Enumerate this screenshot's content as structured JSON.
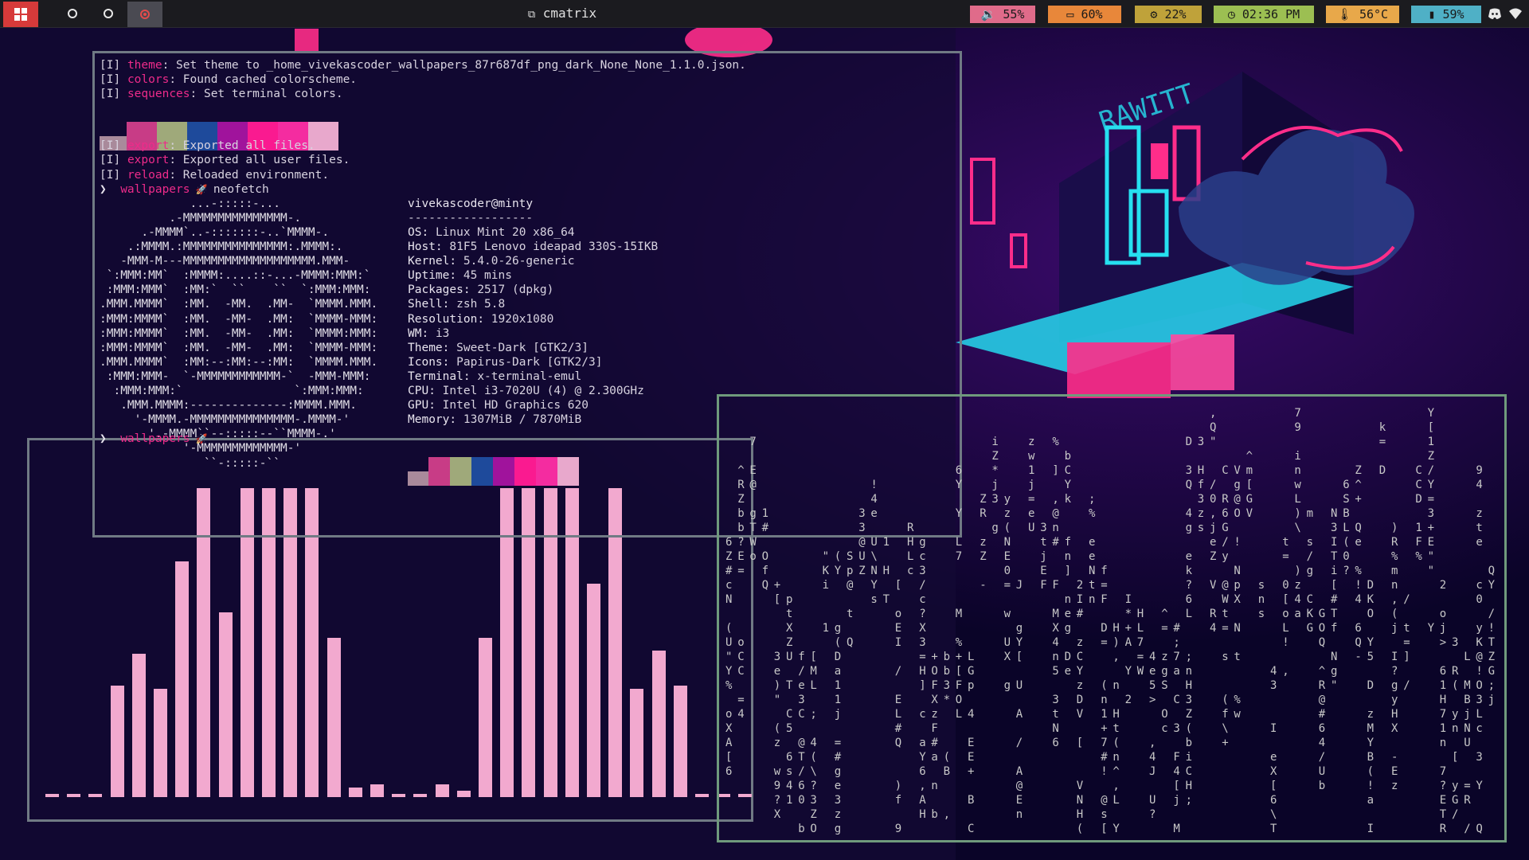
{
  "topbar": {
    "window_title": "cmatrix",
    "modules": [
      {
        "icon": "volume-icon",
        "text": "55%",
        "color": "#e06b8a"
      },
      {
        "icon": "battery-laptop-icon",
        "text": "60%",
        "color": "#e8873a"
      },
      {
        "icon": "cpu-icon",
        "text": "22%",
        "color": "#bfa23a"
      },
      {
        "icon": "clock-icon",
        "text": "02:36 PM",
        "color": "#9cbf52"
      },
      {
        "icon": "temperature-icon",
        "text": "56°C",
        "color": "#e8a84a"
      },
      {
        "icon": "memory-icon",
        "text": "59%",
        "color": "#4fb0c6"
      }
    ],
    "tray": [
      "discord-icon",
      "wifi-icon"
    ]
  },
  "terminal": {
    "lines": [
      {
        "tag": "[I]",
        "kw": "theme",
        "text": ": Set theme to _home_vivekascoder_wallpapers_87r687df_png_dark_None_None_1.1.0.json."
      },
      {
        "tag": "[I]",
        "kw": "colors",
        "text": ": Found cached colorscheme."
      },
      {
        "tag": "[I]",
        "kw": "sequences",
        "text": ": Set terminal colors."
      },
      {
        "tag": "[I]",
        "kw": "export",
        "text": ": Exported all files."
      },
      {
        "tag": "[I]",
        "kw": "export",
        "text": ": Exported all user files."
      },
      {
        "tag": "[I]",
        "kw": "reload",
        "text": ": Reloaded environment."
      }
    ],
    "prompt_dir": "wallpapers",
    "prompt_cmd": "neofetch",
    "prompt2_dir": "wallpapers",
    "palette": [
      "#a98a9b",
      "#c83c86",
      "#9fa97a",
      "#1e4a9b",
      "#a0139c",
      "#fa1a90",
      "#f42ca0",
      "#e8a8cc"
    ],
    "logo": [
      "             ...-:::::-...",
      "          .-MMMMMMMMMMMMMMM-.",
      "      .-MMMM`..-:::::::-..`MMMM-.",
      "    .:MMMM.:MMMMMMMMMMMMMMM:.MMMM:.",
      "   -MMM-M---MMMMMMMMMMMMMMMMMMM.MMM-",
      " `:MMM:MM`  :MMMM:....::-...-MMMM:MMM:`",
      " :MMM:MMM`  :MM:`  ``    ``  `:MMM:MMM:",
      ".MMM.MMMM`  :MM.  -MM.  .MM-  `MMMM.MMM.",
      ":MMM:MMMM`  :MM.  -MM-  .MM:  `MMMM-MMM:",
      ":MMM:MMMM`  :MM.  -MM-  .MM:  `MMMM:MMM:",
      ":MMM:MMMM`  :MM.  -MM-  .MM:  `MMMM-MMM:",
      ".MMM.MMMM`  :MM:--:MM:--:MM:  `MMMM.MMM.",
      " :MMM:MMM-  `-MMMMMMMMMMMM-`  -MMM-MMM:",
      "  :MMM:MMM:`                `:MMM:MMM:",
      "   .MMM.MMMM:--------------:MMMM.MMM.",
      "     '-MMMM.-MMMMMMMMMMMMMMM-.MMMM-'",
      "       '.-MMMM``--:::::--``MMMM-.'",
      "            '-MMMMMMMMMMMMM-'",
      "               ``-:::::-``"
    ],
    "user_host": "vivekascoder@minty",
    "separator": "------------------",
    "info": [
      {
        "k": "OS",
        "v": "Linux Mint 20 x86_64"
      },
      {
        "k": "Host",
        "v": "81F5 Lenovo ideapad 330S-15IKB"
      },
      {
        "k": "Kernel",
        "v": "5.4.0-26-generic"
      },
      {
        "k": "Uptime",
        "v": "45 mins"
      },
      {
        "k": "Packages",
        "v": "2517 (dpkg)"
      },
      {
        "k": "Shell",
        "v": "zsh 5.8"
      },
      {
        "k": "Resolution",
        "v": "1920x1080"
      },
      {
        "k": "WM",
        "v": "i3"
      },
      {
        "k": "Theme",
        "v": "Sweet-Dark [GTK2/3]"
      },
      {
        "k": "Icons",
        "v": "Papirus-Dark [GTK2/3]"
      },
      {
        "k": "Terminal",
        "v": "x-terminal-emul"
      },
      {
        "k": "CPU",
        "v": "Intel i3-7020U (4) @ 2.300GHz"
      },
      {
        "k": "GPU",
        "v": "Intel HD Graphics 620"
      },
      {
        "k": "Memory",
        "v": "1307MiB / 7870MiB"
      }
    ]
  },
  "visualizer": {
    "levels": [
      0.01,
      0.01,
      0.01,
      0.35,
      0.45,
      0.34,
      0.74,
      0.97,
      0.58,
      0.97,
      0.97,
      0.97,
      0.97,
      0.5,
      0.03,
      0.04,
      0.01,
      0.01,
      0.04,
      0.02,
      0.5,
      0.97,
      0.97,
      0.97,
      0.97,
      0.67,
      0.97,
      0.34,
      0.46,
      0.35,
      0.01,
      0.01,
      0.01
    ]
  },
  "matrix": {
    "columns": [
      "  wB,WfY!=Y)a nZU9 H?R6 3=#e^UR[-",
      "   4tm M=pY(+(b 2ZI=X zgcn",
      "  T\\L e 0 i pZ!R ]g",
      "  EgeIp V s 1z*xpdhtQ0O",
      "  0 nOTKjjXKATC6",
      "  1cbYD\"DfM);N",
      "  g5e?@C2w,",
      "  #+?%Q/Na3",
      "  r y N s A [",
      "  0 F L",
      "  Q t 0 a C W 4 E ] E H",
      "  3 / z F J g 4 s t 3 V * B",
      "  7 @ ( = 7 > O \" 4 I V 3",
      "  w",
      "  [ n 1 L o S",
      "  % k U G B o"
    ]
  }
}
